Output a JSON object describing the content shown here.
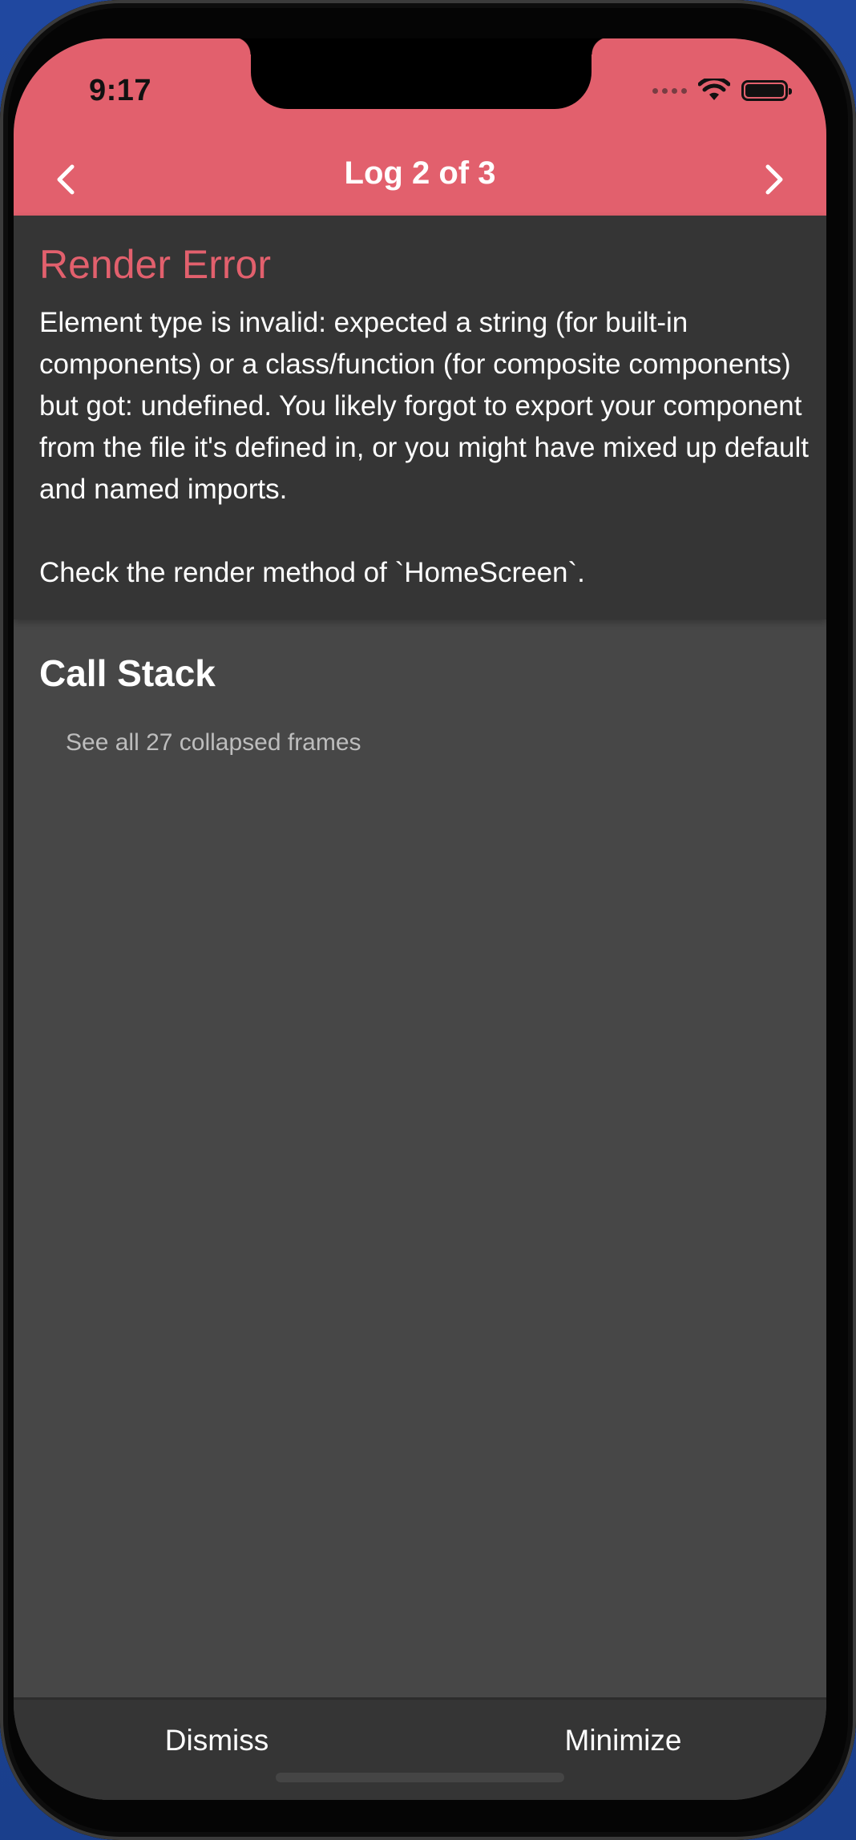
{
  "status_bar": {
    "time": "9:17"
  },
  "header": {
    "title": "Log 2 of 3",
    "prev_icon": "chevron-left-icon",
    "next_icon": "chevron-right-icon",
    "background": "#e2606d"
  },
  "message": {
    "title": "Render Error",
    "body": "Element type is invalid: expected a string (for built-in components) or a class/function (for composite components) but got: undefined. You likely forgot to export your component from the file it's defined in, or you might have mixed up default and named imports.\n\nCheck the render method of `HomeScreen`."
  },
  "call_stack": {
    "title": "Call Stack",
    "collapsed_link": "See all 27 collapsed frames"
  },
  "footer": {
    "dismiss_label": "Dismiss",
    "minimize_label": "Minimize"
  }
}
